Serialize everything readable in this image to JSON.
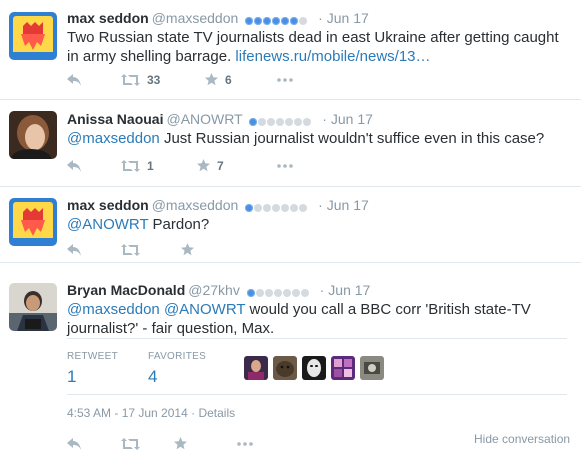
{
  "tweets": [
    {
      "name": "max seddon",
      "handle": "@maxseddon",
      "dots_on": 6,
      "dots_off": 1,
      "date": "Jun 17",
      "text": "Two Russian state TV journalists dead in east Ukraine after getting caught in army shelling barrage.",
      "link": "lifenews.ru/mobile/news/13…",
      "retweets": "33",
      "favorites": "6"
    },
    {
      "name": "Anissa Naouai",
      "handle": "@ANOWRT",
      "dots_on": 1,
      "dots_off": 6,
      "date": "Jun 17",
      "mention": "@maxseddon",
      "text": "Just Russian journalist wouldn't suffice even in this case?",
      "retweets": "1",
      "favorites": "7"
    },
    {
      "name": "max seddon",
      "handle": "@maxseddon",
      "dots_on": 1,
      "dots_off": 6,
      "date": "Jun 17",
      "mention": "@ANOWRT",
      "text": "Pardon?"
    },
    {
      "name": "Bryan MacDonald",
      "handle": "@27khv",
      "dots_on": 1,
      "dots_off": 6,
      "date": "Jun 17",
      "mention1": "@maxseddon",
      "mention2": "@ANOWRT",
      "text1": "would you call a BBC corr 'British state-TV",
      "text2": "journalist?' - fair question, Max.",
      "retweet_label": "RETWEET",
      "retweet_count": "1",
      "favorites_label": "FAVORITES",
      "favorites_count": "4",
      "timestamp": "4:53 AM - 17 Jun 2014",
      "details": "Details",
      "hide_conversation": "Hide conversation"
    }
  ],
  "colors": {
    "link": "#2b7bb9",
    "muted": "#8899a6",
    "text": "#292f33",
    "verified_dot": "#4a90e2"
  },
  "icons": [
    "reply-icon",
    "retweet-icon",
    "favorite-icon",
    "more-icon"
  ]
}
